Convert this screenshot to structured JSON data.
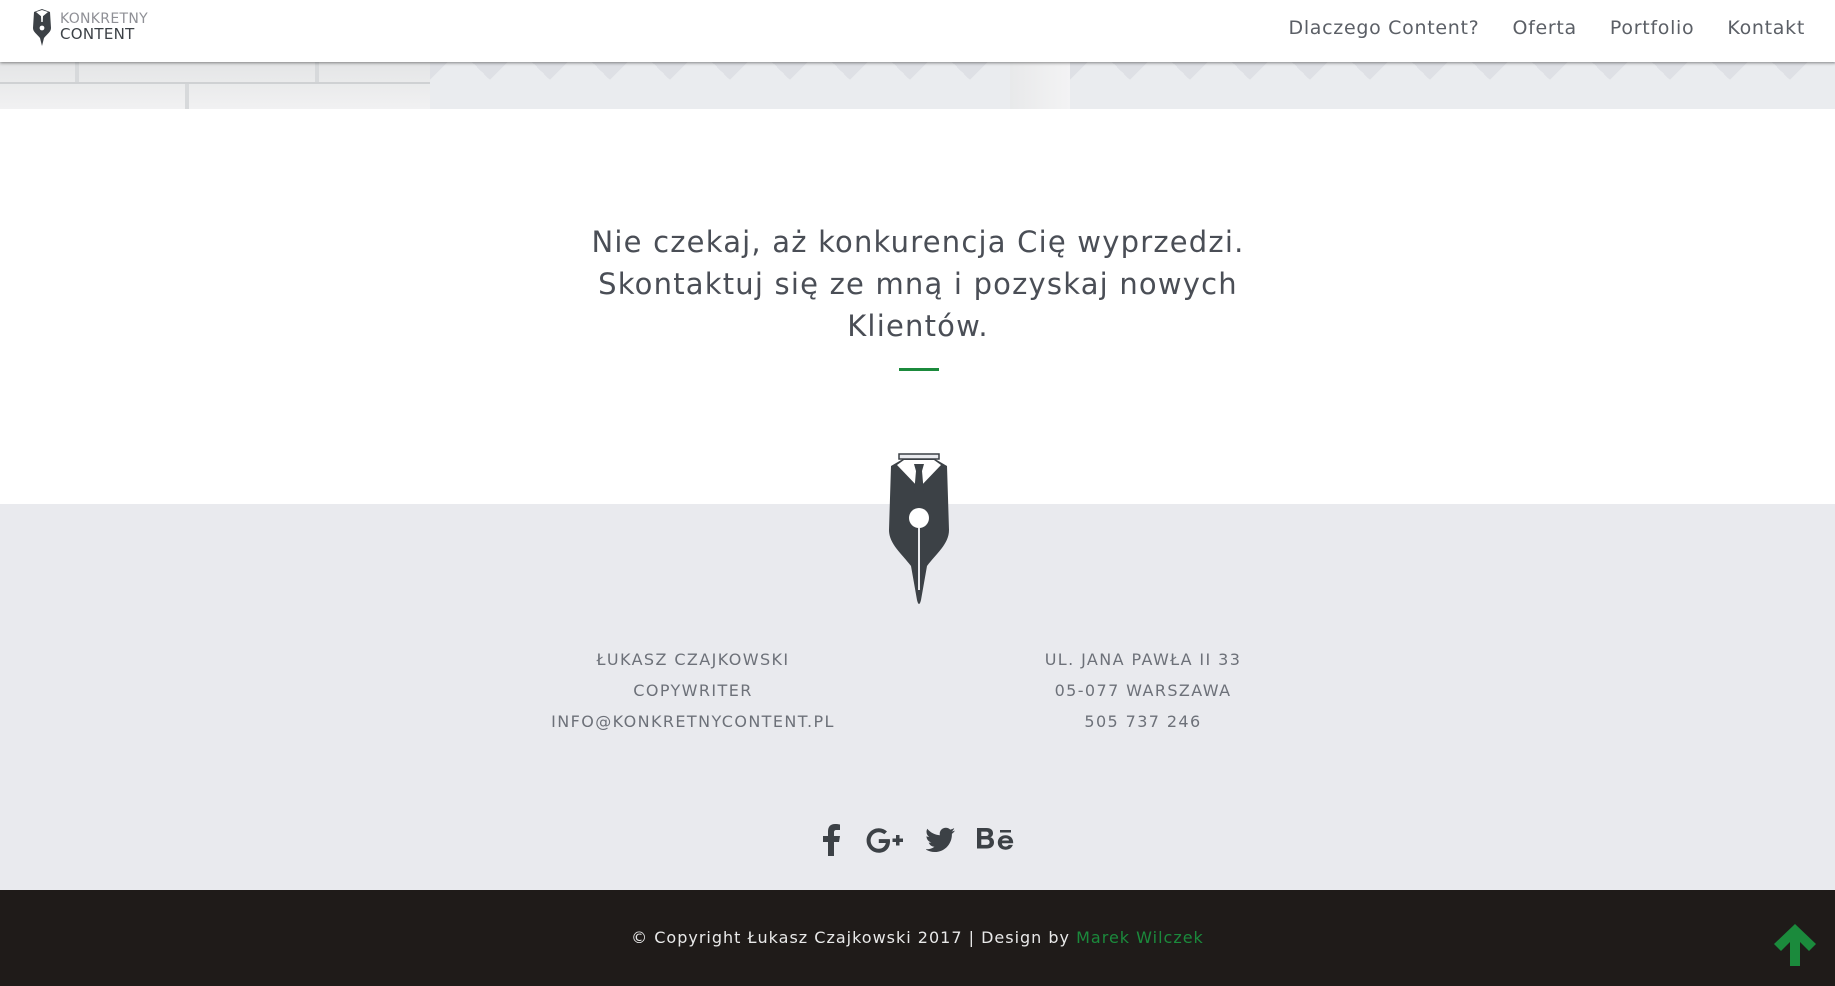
{
  "header": {
    "logo": {
      "line1": "KONKRETNY",
      "line2": "CONTENT",
      "icon": "pen-logo-icon"
    },
    "nav": [
      {
        "label": "Dlaczego Content?"
      },
      {
        "label": "Oferta"
      },
      {
        "label": "Portfolio"
      },
      {
        "label": "Kontakt"
      }
    ]
  },
  "cta": {
    "line1": "Nie czekaj, aż konkurencja Cię wyprzedzi.",
    "line2": "Skontaktuj się ze mną i pozyskaj nowych",
    "line3": "Klientów."
  },
  "contact": {
    "left": [
      "ŁUKASZ CZAJKOWSKI",
      "COPYWRITER",
      "INFO@KONKRETNYCONTENT.PL"
    ],
    "right": [
      "UL. JANA PAWŁA II 33",
      "05-077 WARSZAWA",
      "505 737 246"
    ]
  },
  "social": [
    {
      "icon": "facebook-icon"
    },
    {
      "icon": "google-plus-icon"
    },
    {
      "icon": "twitter-icon"
    },
    {
      "icon": "behance-icon"
    }
  ],
  "footer": {
    "copyright": "© Copyright Łukasz Czajkowski 2017 | Design by",
    "designer": "Marek Wilczek",
    "back_to_top_icon": "arrow-up-icon"
  },
  "colors": {
    "accent": "#1b8a3c",
    "text": "#4a4e56",
    "footer_bg": "#e9eaee",
    "bottom_bar": "#1f1b19",
    "icon_dark": "#3c4146"
  }
}
